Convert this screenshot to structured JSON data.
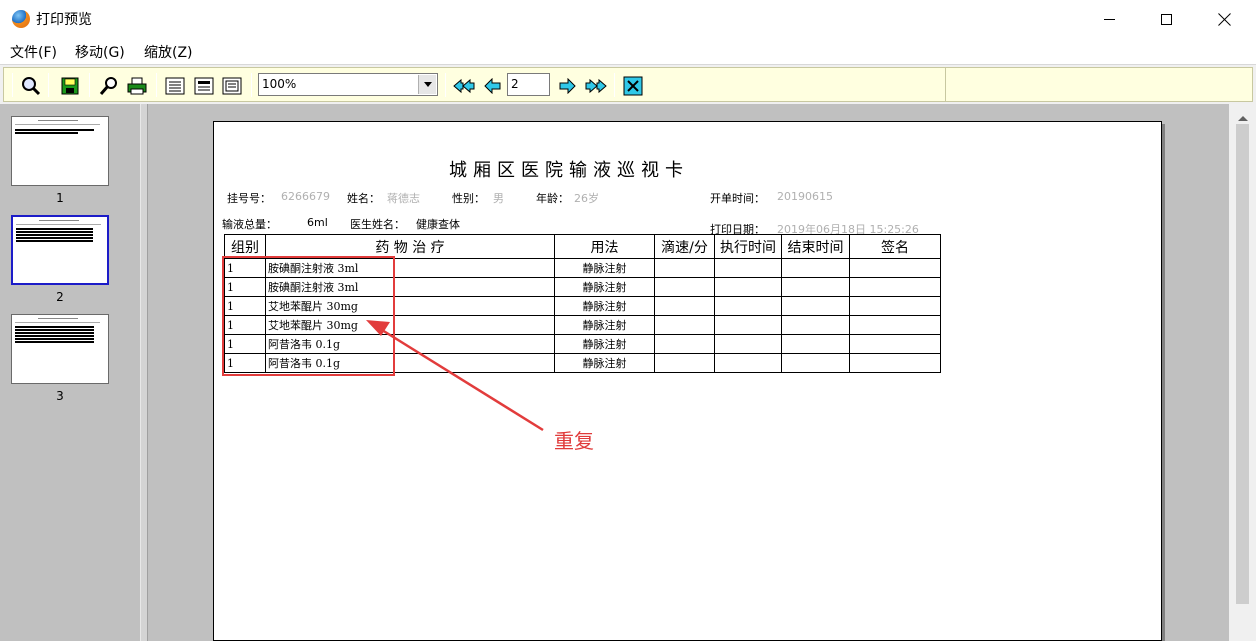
{
  "window": {
    "title": "打印预览"
  },
  "menu": {
    "items": [
      {
        "label": "文件(F)"
      },
      {
        "label": "移动(G)"
      },
      {
        "label": "缩放(Z)"
      }
    ]
  },
  "toolbar": {
    "zoom_value": "100%",
    "page_number": "2"
  },
  "thumbnails": [
    {
      "label": "1"
    },
    {
      "label": "2",
      "selected": true
    },
    {
      "label": "3"
    }
  ],
  "document": {
    "title": "城厢区医院输液巡视卡",
    "info": {
      "reg_no_label": "挂号号：",
      "reg_no_value": "6266679",
      "name_label": "姓名：",
      "name_value": "蒋德志",
      "gender_label": "性别：",
      "gender_value": "男",
      "age_label": "年龄：",
      "age_value": "26岁",
      "order_time_label": "开单时间：",
      "order_time_value": "20190615",
      "total_label": "输液总量：",
      "total_value": "6ml",
      "doctor_label": "医生姓名：",
      "doctor_value": "健康查体",
      "print_date_label": "打印日期：",
      "print_date_value": "2019年06月18日 15:25:26"
    },
    "table": {
      "headers": [
        "组别",
        "药 物 治 疗",
        "用法",
        "滴速/分",
        "执行时间",
        "结束时间",
        "签名"
      ],
      "rows": [
        {
          "group": "1",
          "drug": "胺碘酮注射液 3ml",
          "method": "静脉注射"
        },
        {
          "group": "1",
          "drug": "胺碘酮注射液 3ml",
          "method": "静脉注射"
        },
        {
          "group": "1",
          "drug": "艾地苯醌片 30mg",
          "method": "静脉注射"
        },
        {
          "group": "1",
          "drug": "艾地苯醌片 30mg",
          "method": "静脉注射"
        },
        {
          "group": "1",
          "drug": "阿昔洛韦 0.1g",
          "method": "静脉注射"
        },
        {
          "group": "1",
          "drug": "阿昔洛韦 0.1g",
          "method": "静脉注射"
        }
      ]
    }
  },
  "annotation": {
    "text": "重复",
    "color": "#e23c3c"
  }
}
